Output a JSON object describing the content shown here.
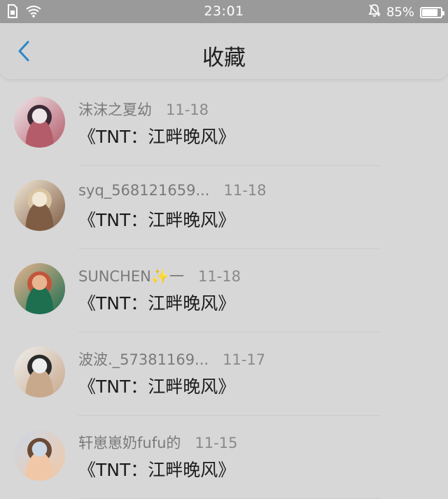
{
  "status_bar": {
    "time": "23:01",
    "battery": "85%",
    "battery_level": 0.85,
    "icons": [
      "sim-card-icon",
      "wifi-icon",
      "bell-off-icon",
      "battery-icon"
    ]
  },
  "header": {
    "title": "收藏",
    "back_icon": "chevron-left-icon",
    "accent": "#2a86c6"
  },
  "favorites": [
    {
      "name": "沫沫之夏幼",
      "date": "11-18",
      "work": "《TNT：江畔晚风》",
      "avatar_colors": [
        "#3b2a35",
        "#b45c6a",
        "#efe6ea"
      ]
    },
    {
      "name": "syq_568121659...",
      "date": "11-18",
      "work": "《TNT：江畔晚风》",
      "avatar_colors": [
        "#d9c4a2",
        "#7f5c44",
        "#f1e8d6"
      ]
    },
    {
      "name": "SUNCHEN✨一",
      "date": "11-18",
      "work": "《TNT：江畔晚风》",
      "avatar_colors": [
        "#c4553b",
        "#1e6e50",
        "#e7b590"
      ]
    },
    {
      "name": "波波._57381169...",
      "date": "11-17",
      "work": "《TNT：江畔晚风》",
      "avatar_colors": [
        "#2a2a2a",
        "#c9a98c",
        "#eeeeee"
      ]
    },
    {
      "name": "轩崽崽奶fufu的",
      "date": "11-15",
      "work": "《TNT：江畔晚风》",
      "avatar_colors": [
        "#6b4a36",
        "#f0c8a8",
        "#ccd8e6"
      ]
    }
  ]
}
